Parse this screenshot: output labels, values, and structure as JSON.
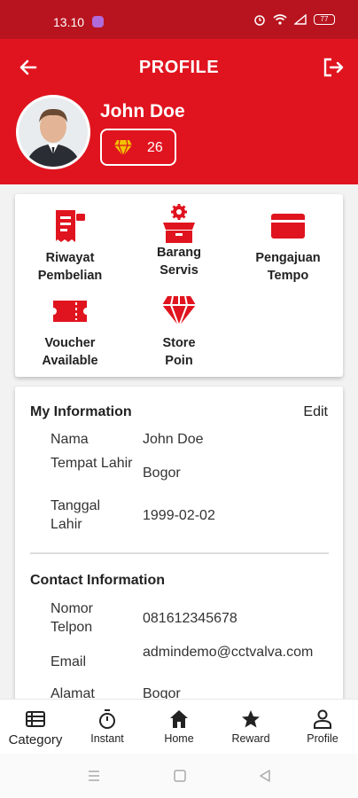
{
  "status_bar": {
    "time": "13.10",
    "battery": "77"
  },
  "header": {
    "title": "PROFILE"
  },
  "profile": {
    "name": "John Doe",
    "points": "26"
  },
  "menu": {
    "items": [
      {
        "label_line1": "Riwayat",
        "label_line2": "Pembelian",
        "icon": "receipt-icon"
      },
      {
        "label_line1": "Barang",
        "label_line2": "Servis",
        "icon": "service-box-icon"
      },
      {
        "label_line1": "Pengajuan",
        "label_line2": "Tempo",
        "icon": "card-icon"
      },
      {
        "label_line1": "Voucher",
        "label_line2": "Available",
        "icon": "ticket-icon"
      },
      {
        "label_line1": "Store",
        "label_line2": "Poin",
        "icon": "diamond-icon"
      }
    ]
  },
  "my_info": {
    "title": "My Information",
    "edit_label": "Edit",
    "rows": [
      {
        "label": "Nama",
        "value": "John Doe"
      },
      {
        "label": "Tempat Lahir",
        "value": "Bogor"
      },
      {
        "label": "Tanggal Lahir",
        "value": "1999-02-02"
      }
    ]
  },
  "contact_info": {
    "title": "Contact Information",
    "rows": [
      {
        "label": "Nomor Telpon",
        "value": "081612345678"
      },
      {
        "label": "Email",
        "value": "admindemo@cctvalva.com"
      },
      {
        "label": "Alamat",
        "value": "Bogor"
      }
    ]
  },
  "bottom_nav": {
    "items": [
      {
        "label": "Category",
        "icon": "category-icon"
      },
      {
        "label": "Instant",
        "icon": "stopwatch-icon"
      },
      {
        "label": "Home",
        "icon": "home-icon"
      },
      {
        "label": "Reward",
        "icon": "star-icon"
      },
      {
        "label": "Profile",
        "icon": "profile-icon"
      }
    ]
  },
  "colors": {
    "brand_red": "#e0141f",
    "status_bar": "#b8141f",
    "gem_gold": "#f2c200"
  }
}
